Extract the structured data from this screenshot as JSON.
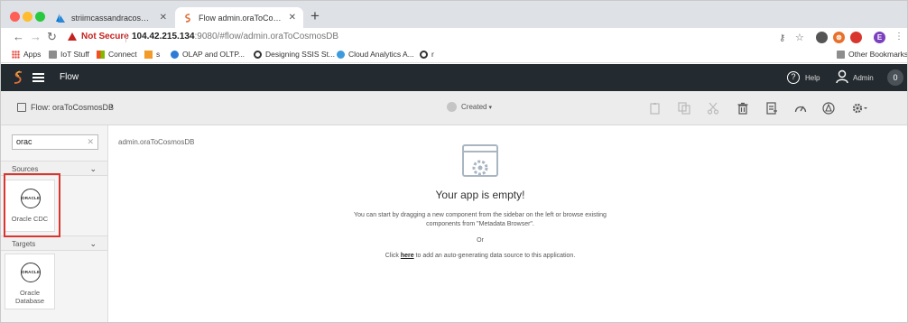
{
  "browser": {
    "tabs": [
      {
        "title": "striimcassandracosmos - Data",
        "active": false
      },
      {
        "title": "Flow admin.oraToCosmosDB",
        "active": true
      }
    ],
    "new_tab": "+",
    "security_label": "Not Secure",
    "url_host": "104.42.215.134",
    "url_rest": ":9080/#flow/admin.oraToCosmosDB",
    "bookmarks": [
      "Apps",
      "IoT Stuff",
      "Connect",
      "s",
      "OLAP and OLTP...",
      "Designing SSIS St...",
      "Cloud Analytics A...",
      "r"
    ],
    "other_bookmarks": "Other Bookmarks",
    "profile_initial": "E"
  },
  "app": {
    "title": "Flow",
    "help_label": "Help",
    "user_label": "Admin",
    "notification_count": "0"
  },
  "toolbar": {
    "breadcrumb": "Flow: oraToCosmosDB",
    "status": "Created"
  },
  "sidebar": {
    "search_value": "orac",
    "sources_label": "Sources",
    "targets_label": "Targets",
    "sources": [
      {
        "icon_text": "ORACLE",
        "label": "Oracle CDC"
      }
    ],
    "targets": [
      {
        "icon_text": "ORACLE",
        "label": "Oracle Database"
      }
    ]
  },
  "canvas": {
    "app_path": "admin.oraToCosmosDB",
    "empty_title": "Your app is empty!",
    "empty_desc": "You can start by dragging a new component from the sidebar on the left or browse existing components from \"Metadata Browser\".",
    "or": "Or",
    "click_prefix": "Click ",
    "click_link": "here",
    "click_suffix": " to add an auto-generating data source to this application."
  },
  "colors": {
    "header_bg": "#242b30",
    "highlight": "#d9362f",
    "not_secure": "#c5221f"
  }
}
